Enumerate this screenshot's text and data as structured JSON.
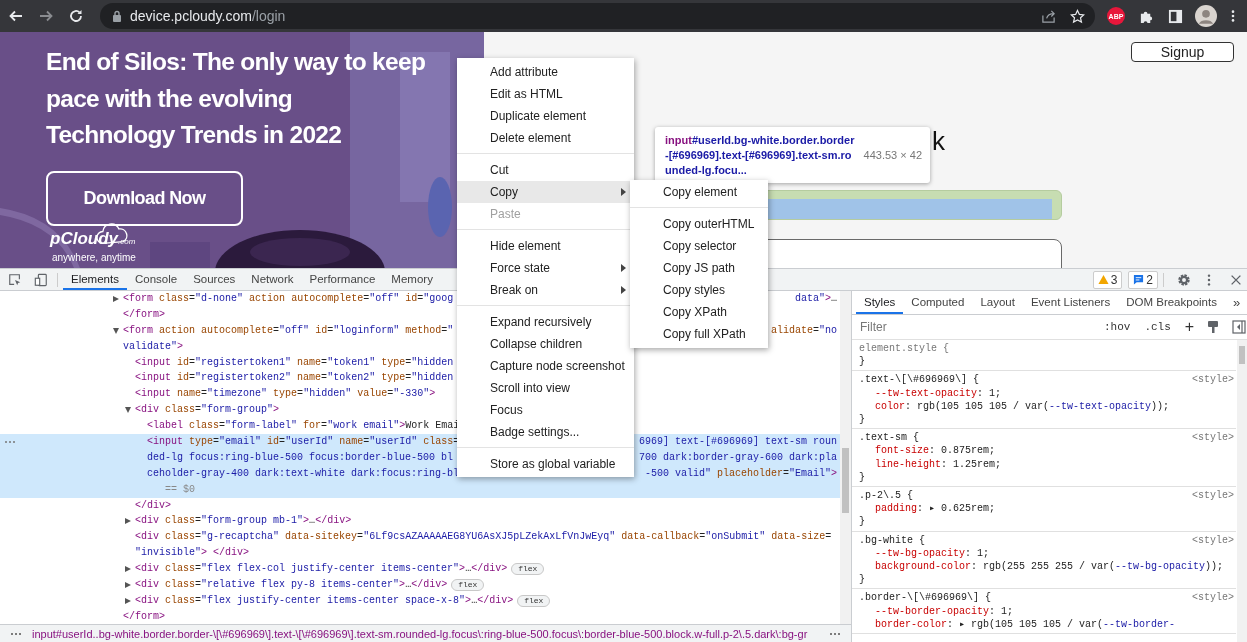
{
  "browser": {
    "host": "device.pcloudy.com",
    "path": "/login",
    "extension": "ABP"
  },
  "page": {
    "hero": {
      "logo": "pCloudy",
      "logo_suffix": ".com",
      "tagline": "anywhere, anytime",
      "headline_lines": [
        "End of Silos: The only way to keep",
        "pace with the evolving",
        "Technology Trends in 2022"
      ],
      "button": "Download Now"
    },
    "signup": "Signup",
    "heading": "k"
  },
  "inspect_tooltip": {
    "tag": "input",
    "selector": "#userId.bg-white.border.border-[#696969].text-[#696969].text-sm.rounded-lg.focu...",
    "size": "443.53 × 42"
  },
  "devtools": {
    "tabs": [
      {
        "label": "Elements",
        "selected": true
      },
      {
        "label": "Console",
        "selected": false
      },
      {
        "label": "Sources",
        "selected": false
      },
      {
        "label": "Network",
        "selected": false
      },
      {
        "label": "Performance",
        "selected": false
      },
      {
        "label": "Memory",
        "selected": false
      }
    ],
    "warnings": "3",
    "messages": "2",
    "elements": {
      "nodes": [
        {
          "lines": [
            {
              "text": "<form class=\"d-none\" action autocomplete=\"off\" id=\"goog",
              "tail": "data\">…"
            }
          ],
          "expanded": false,
          "selected": false,
          "close": "</form>"
        },
        {
          "lines": [
            {
              "text": "<form action autocomplete=\"off\" id=\"loginform\" method=\"",
              "tail": "alidate=\"no"
            },
            {
              "text": "validate\">"
            }
          ],
          "expanded": true,
          "selected": false,
          "close": "</form>",
          "children": [
            {
              "lines": [
                {
                  "text": "<input id=\"registertoken1\" name=\"token1\" type=\"hidden"
                }
              ],
              "selected": false
            },
            {
              "lines": [
                {
                  "text": "<input id=\"registertoken2\" name=\"token2\" type=\"hidden"
                }
              ],
              "selected": false
            },
            {
              "lines": [
                {
                  "text": "<input name=\"timezone\" type=\"hidden\" value=\"-330\">"
                }
              ],
              "selected": false
            },
            {
              "lines": [
                {
                  "text": "<div class=\"form-group\">"
                }
              ],
              "expanded": true,
              "selected": false,
              "close": "</div>",
              "children": [
                {
                  "lines": [
                    {
                      "text": "<label class=\"form-label\" for=\"work email\">Work Emai"
                    }
                  ],
                  "selected": false
                },
                {
                  "lines": [
                    {
                      "text": "<input type=\"email\" id=\"userId\" name=\"userId\" class=",
                      "tail": "6969] text-[#696969] text-sm roun"
                    },
                    {
                      "text": "ded-lg focus:ring-blue-500 focus:border-blue-500 bl",
                      "tail": "700 dark:border-gray-600 dark:pla"
                    },
                    {
                      "text": "ceholder-gray-400 dark:text-white dark:focus:ring-bl",
                      "tail": "-500 valid\" placeholder=\"Email\">"
                    },
                    {
                      "text": "== $0",
                      "kind": "console-ref"
                    }
                  ],
                  "selected": true
                }
              ]
            },
            {
              "lines": [
                {
                  "text": "<div class=\"form-group mb-1\">…</div>"
                }
              ],
              "expanded": false,
              "selected": false
            },
            {
              "lines": [
                {
                  "text": "<div class=\"g-recaptcha\" data-sitekey=\"6Lf9csAZAAAAAEG8YU6AsXJ5pLZekAxLfVnJwEyq\" data-callback=\"onSubmit\" data-size="
                },
                {
                  "text": "\"invisible\"> </div>"
                }
              ],
              "selected": false
            },
            {
              "lines": [
                {
                  "text": "<div class=\"flex flex-col justify-center items-center\">…</div>"
                }
              ],
              "expanded": false,
              "selected": false,
              "badge": "flex"
            },
            {
              "lines": [
                {
                  "text": "<div class=\"relative flex py-8 items-center\">…</div>"
                }
              ],
              "expanded": false,
              "selected": false,
              "badge": "flex"
            },
            {
              "lines": [
                {
                  "text": "<div class=\"flex justify-center items-center space-x-8\">…</div>"
                }
              ],
              "expanded": false,
              "selected": false,
              "badge": "flex"
            }
          ]
        }
      ],
      "breadcrumb": "input#userId..bg-white.border.border-\\[\\#696969\\].text-\\[\\#696969\\].text-sm.rounded-lg.focus\\:ring-blue-500.focus\\:border-blue-500.block.w-full.p-2\\.5.dark\\:bg-gr"
    },
    "styles": {
      "tabs": [
        {
          "label": "Styles",
          "selected": true
        },
        {
          "label": "Computed",
          "selected": false
        },
        {
          "label": "Layout",
          "selected": false
        },
        {
          "label": "Event Listeners",
          "selected": false
        },
        {
          "label": "DOM Breakpoints",
          "selected": false
        }
      ],
      "more": "»",
      "filter_placeholder": "Filter",
      "hov": ":hov",
      "cls": ".cls",
      "add": "+",
      "rules": [
        {
          "selector": "element.style {",
          "close": "}"
        },
        {
          "selector": ".text-\\[\\#696969\\] {",
          "source": "<style>",
          "props": [
            "--tw-text-opacity: 1;",
            "color: rgb(105 105 105 / var(--tw-text-opacity));"
          ],
          "close": "}"
        },
        {
          "selector": ".text-sm {",
          "source": "<style>",
          "props": [
            "font-size: 0.875rem;",
            "line-height: 1.25rem;"
          ],
          "close": "}"
        },
        {
          "selector": ".p-2\\.5 {",
          "source": "<style>",
          "props": [
            "padding: ▸ 0.625rem;"
          ],
          "close": "}"
        },
        {
          "selector": ".bg-white {",
          "source": "<style>",
          "props": [
            "--tw-bg-opacity: 1;",
            "background-color: rgb(255 255 255 / var(--tw-bg-opacity));"
          ],
          "close": "}"
        },
        {
          "selector": ".border-\\[\\#696969\\] {",
          "source": "<style>",
          "props": [
            "--tw-border-opacity: 1;",
            "border-color: ▸ rgb(105 105 105 / var(--tw-border-"
          ]
        }
      ]
    }
  },
  "context_menu": {
    "items": [
      {
        "kind": "item",
        "label": "Add attribute",
        "selected": false,
        "disabled": false,
        "submenu": false
      },
      {
        "kind": "item",
        "label": "Edit as HTML",
        "selected": false,
        "disabled": false,
        "submenu": false
      },
      {
        "kind": "item",
        "label": "Duplicate element",
        "selected": false,
        "disabled": false,
        "submenu": false
      },
      {
        "kind": "item",
        "label": "Delete element",
        "selected": false,
        "disabled": false,
        "submenu": false
      },
      {
        "kind": "separator"
      },
      {
        "kind": "item",
        "label": "Cut",
        "selected": false,
        "disabled": false,
        "submenu": false
      },
      {
        "kind": "item",
        "label": "Copy",
        "selected": true,
        "disabled": false,
        "submenu": true
      },
      {
        "kind": "item",
        "label": "Paste",
        "selected": false,
        "disabled": true,
        "submenu": false
      },
      {
        "kind": "separator"
      },
      {
        "kind": "item",
        "label": "Hide element",
        "selected": false,
        "disabled": false,
        "submenu": false
      },
      {
        "kind": "item",
        "label": "Force state",
        "selected": false,
        "disabled": false,
        "submenu": true
      },
      {
        "kind": "item",
        "label": "Break on",
        "selected": false,
        "disabled": false,
        "submenu": true
      },
      {
        "kind": "separator"
      },
      {
        "kind": "item",
        "label": "Expand recursively",
        "selected": false,
        "disabled": false,
        "submenu": false
      },
      {
        "kind": "item",
        "label": "Collapse children",
        "selected": false,
        "disabled": false,
        "submenu": false
      },
      {
        "kind": "item",
        "label": "Capture node screenshot",
        "selected": false,
        "disabled": false,
        "submenu": false
      },
      {
        "kind": "item",
        "label": "Scroll into view",
        "selected": false,
        "disabled": false,
        "submenu": false
      },
      {
        "kind": "item",
        "label": "Focus",
        "selected": false,
        "disabled": false,
        "submenu": false
      },
      {
        "kind": "item",
        "label": "Badge settings...",
        "selected": false,
        "disabled": false,
        "submenu": false
      },
      {
        "kind": "separator"
      },
      {
        "kind": "item",
        "label": "Store as global variable",
        "selected": false,
        "disabled": false,
        "submenu": false
      }
    ]
  },
  "copy_submenu": {
    "items": [
      {
        "kind": "item",
        "label": "Copy element",
        "selected": false,
        "disabled": false,
        "submenu": false
      },
      {
        "kind": "separator"
      },
      {
        "kind": "item",
        "label": "Copy outerHTML",
        "selected": false,
        "disabled": false,
        "submenu": false
      },
      {
        "kind": "item",
        "label": "Copy selector",
        "selected": false,
        "disabled": false,
        "submenu": false
      },
      {
        "kind": "item",
        "label": "Copy JS path",
        "selected": false,
        "disabled": false,
        "submenu": false
      },
      {
        "kind": "item",
        "label": "Copy styles",
        "selected": false,
        "disabled": false,
        "submenu": false
      },
      {
        "kind": "item",
        "label": "Copy XPath",
        "selected": false,
        "disabled": false,
        "submenu": false
      },
      {
        "kind": "item",
        "label": "Copy full XPath",
        "selected": false,
        "disabled": false,
        "submenu": false
      }
    ]
  }
}
